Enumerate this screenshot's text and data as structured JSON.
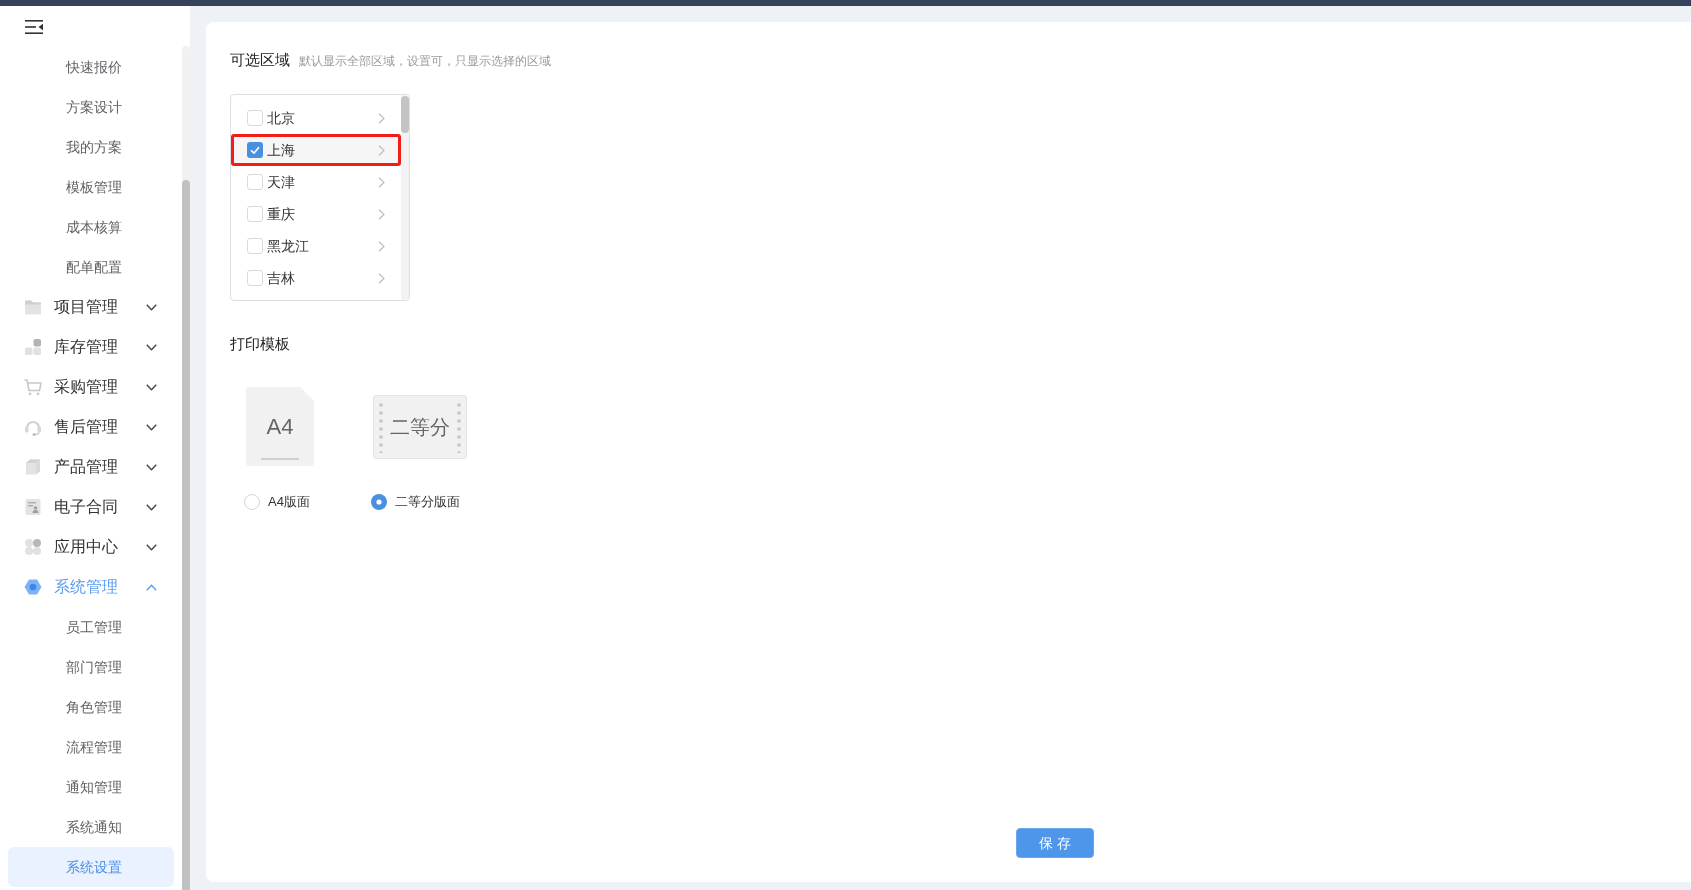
{
  "sidebar": {
    "items": [
      {
        "kind": "link",
        "label": "快速报价",
        "selected": false
      },
      {
        "kind": "link",
        "label": "方案设计",
        "selected": false
      },
      {
        "kind": "link",
        "label": "我的方案",
        "selected": false
      },
      {
        "kind": "link",
        "label": "模板管理",
        "selected": false
      },
      {
        "kind": "link",
        "label": "成本核算",
        "selected": false
      },
      {
        "kind": "link",
        "label": "配单配置",
        "selected": false
      },
      {
        "kind": "group",
        "label": "项目管理",
        "expanded": false
      },
      {
        "kind": "group",
        "label": "库存管理",
        "expanded": false
      },
      {
        "kind": "group",
        "label": "采购管理",
        "expanded": false
      },
      {
        "kind": "group",
        "label": "售后管理",
        "expanded": false
      },
      {
        "kind": "group",
        "label": "产品管理",
        "expanded": false
      },
      {
        "kind": "group",
        "label": "电子合同",
        "expanded": false
      },
      {
        "kind": "group",
        "label": "应用中心",
        "expanded": false
      },
      {
        "kind": "group",
        "label": "系统管理",
        "expanded": true,
        "children": [
          {
            "label": "员工管理",
            "selected": false
          },
          {
            "label": "部门管理",
            "selected": false
          },
          {
            "label": "角色管理",
            "selected": false
          },
          {
            "label": "流程管理",
            "selected": false
          },
          {
            "label": "通知管理",
            "selected": false
          },
          {
            "label": "系统通知",
            "selected": false
          },
          {
            "label": "系统设置",
            "selected": true
          }
        ]
      }
    ]
  },
  "regions": {
    "title": "可选区域",
    "hint": "默认显示全部区域，设置可，只显示选择的区域",
    "items": [
      {
        "label": "北京",
        "checked": false,
        "highlighted": false
      },
      {
        "label": "上海",
        "checked": true,
        "highlighted": true
      },
      {
        "label": "天津",
        "checked": false,
        "highlighted": false
      },
      {
        "label": "重庆",
        "checked": false,
        "highlighted": false
      },
      {
        "label": "黑龙江",
        "checked": false,
        "highlighted": false
      },
      {
        "label": "吉林",
        "checked": false,
        "highlighted": false
      }
    ]
  },
  "print_template": {
    "title": "打印模板",
    "options": [
      {
        "kind": "a4",
        "preview": "A4",
        "label": "A4版面",
        "selected": false
      },
      {
        "kind": "half",
        "preview": "二等分",
        "label": "二等分版面",
        "selected": true
      }
    ]
  },
  "save_button": "保存"
}
